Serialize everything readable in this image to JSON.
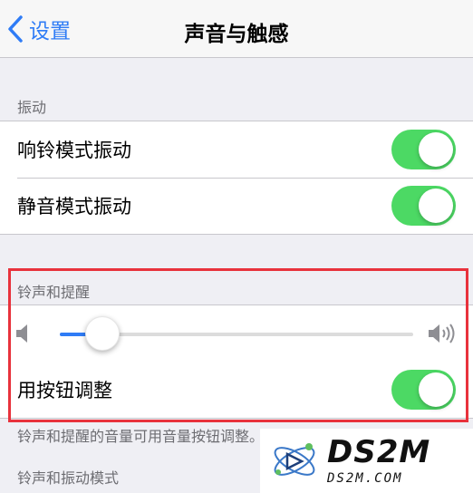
{
  "nav": {
    "back_label": "设置",
    "title": "声音与触感"
  },
  "vibration": {
    "header": "振动",
    "rows": [
      {
        "label": "响铃模式振动",
        "on": true
      },
      {
        "label": "静音模式振动",
        "on": true
      }
    ]
  },
  "ringer": {
    "header": "铃声和提醒",
    "volume_fraction": 0.12,
    "buttons_row": {
      "label": "用按钮调整",
      "on": true
    },
    "footer": "铃声和提醒的音量可用音量按钮调整。"
  },
  "next_section": {
    "header": "铃声和振动模式"
  },
  "watermark": {
    "brand": "DS2M",
    "domain": "DS2M.COM"
  },
  "colors": {
    "accent": "#2f7cf6",
    "switch_on": "#4cd964",
    "highlight": "#e8323c"
  }
}
